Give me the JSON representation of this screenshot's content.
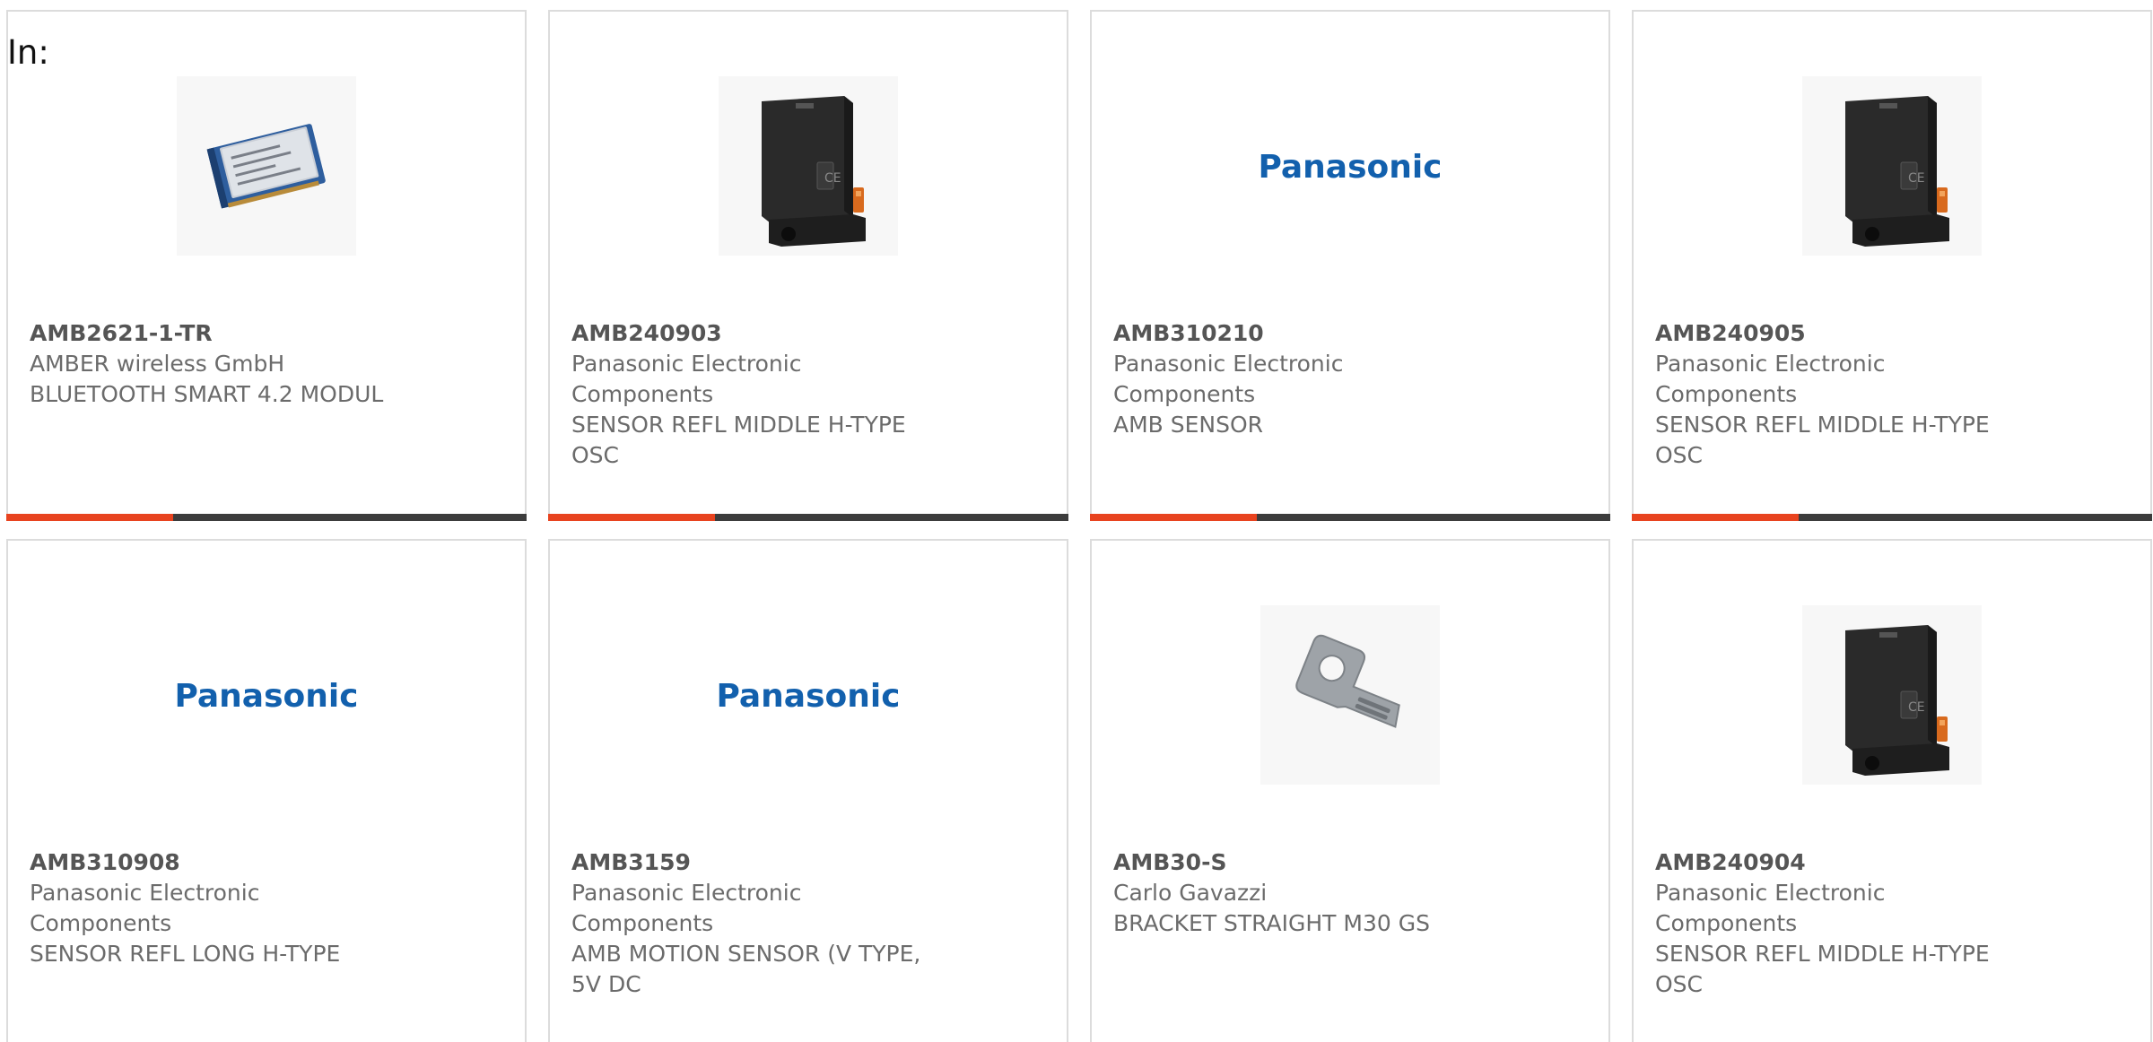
{
  "header": {
    "in_label": "In:"
  },
  "colors": {
    "accent": "#e8431f",
    "bar_dark": "#3c3c3c",
    "panasonic_blue": "#1260ad"
  },
  "products": [
    {
      "part_number": "AMB2621-1-TR",
      "manufacturer": "AMBER wireless GmbH",
      "description": "BLUETOOTH SMART 4.2 MODUL",
      "image": "bluetooth-module-icon",
      "accent_fraction": 0.32
    },
    {
      "part_number": "AMB240903",
      "manufacturer": "Panasonic Electronic Components",
      "description": "SENSOR REFL MIDDLE H-TYPE OSC",
      "image": "sensor-icon",
      "accent_fraction": 0.32
    },
    {
      "part_number": "AMB310210",
      "manufacturer": "Panasonic Electronic Components",
      "description": "AMB SENSOR",
      "image": "panasonic-logo",
      "logo_text": "Panasonic",
      "accent_fraction": 0.32
    },
    {
      "part_number": "AMB240905",
      "manufacturer": "Panasonic Electronic Components",
      "description": "SENSOR REFL MIDDLE H-TYPE OSC",
      "image": "sensor-icon",
      "accent_fraction": 0.32
    },
    {
      "part_number": "AMB310908",
      "manufacturer": "Panasonic Electronic Components",
      "description": "SENSOR REFL LONG H-TYPE",
      "image": "panasonic-logo",
      "logo_text": "Panasonic"
    },
    {
      "part_number": "AMB3159",
      "manufacturer": "Panasonic Electronic Components",
      "description": "AMB MOTION SENSOR (V TYPE, 5V DC",
      "image": "panasonic-logo",
      "logo_text": "Panasonic"
    },
    {
      "part_number": "AMB30-S",
      "manufacturer": "Carlo Gavazzi",
      "description": "BRACKET STRAIGHT M30 GS",
      "image": "bracket-icon"
    },
    {
      "part_number": "AMB240904",
      "manufacturer": "Panasonic Electronic Components",
      "description": "SENSOR REFL MIDDLE H-TYPE OSC",
      "image": "sensor-icon"
    }
  ]
}
